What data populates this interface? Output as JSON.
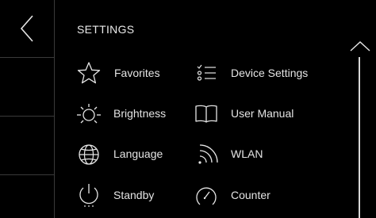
{
  "header": {
    "title": "SETTINGS"
  },
  "nav": {
    "back_icon": "chevron-left-icon",
    "scroll_up_icon": "chevron-up-icon"
  },
  "menu": {
    "favorites": "Favorites",
    "device_settings": "Device Settings",
    "brightness": "Brightness",
    "user_manual": "User Manual",
    "language": "Language",
    "wlan": "WLAN",
    "standby": "Standby",
    "counter": "Counter"
  },
  "colors": {
    "background": "#000000",
    "text": "#e6e6e6",
    "divider": "#3a3a3a"
  }
}
